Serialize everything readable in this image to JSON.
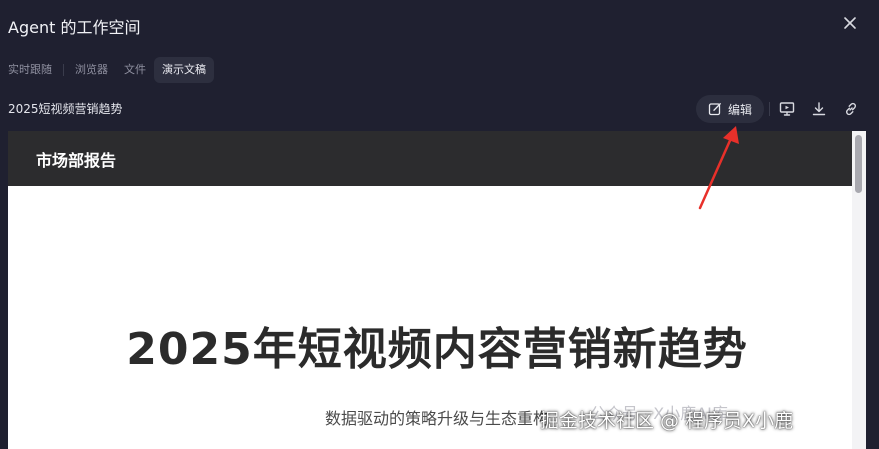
{
  "window": {
    "title": "Agent 的工作空间",
    "close_icon": "close-icon"
  },
  "tabs": [
    {
      "label": "实时跟随",
      "active": false
    },
    {
      "label": "浏览器",
      "active": false
    },
    {
      "label": "文件",
      "active": false
    },
    {
      "label": "演示文稿",
      "active": true
    }
  ],
  "document": {
    "title": "2025短视频营销趋势"
  },
  "toolbar": {
    "edit_label": "编辑",
    "edit_icon": "edit-icon",
    "present_icon": "present-icon",
    "download_icon": "download-icon",
    "link_icon": "link-icon"
  },
  "slide": {
    "header_title": "市场部报告",
    "main_title": "2025年短视频内容营销新趋势",
    "subtitle": "数据驱动的策略升级与生态重构"
  },
  "annotation": {
    "arrow_color": "#e8302a"
  },
  "watermark": {
    "text": "掘金技术社区 @ 程序员X小鹿",
    "faint_text": "公众号 · X小鹿AI库"
  },
  "colors": {
    "panel_bg": "#1f2030",
    "tab_active_bg": "#2c2e3e",
    "slide_header_bg": "#2c2c2e"
  }
}
